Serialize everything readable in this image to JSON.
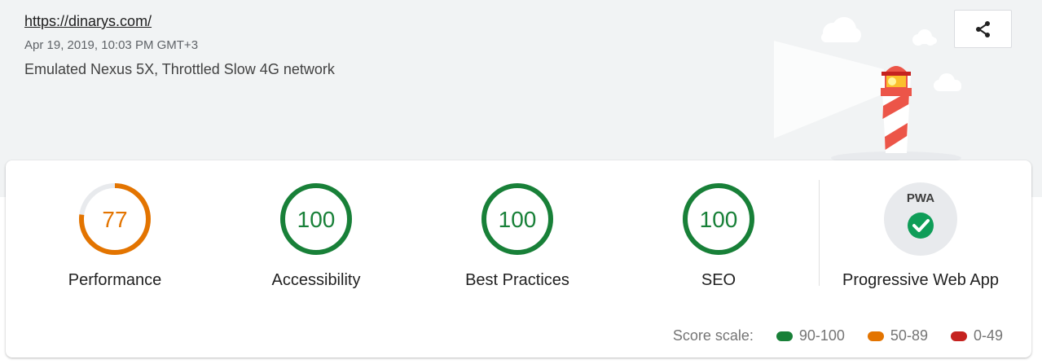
{
  "header": {
    "url": "https://dinarys.com/",
    "timestamp": "Apr 19, 2019, 10:03 PM GMT+3",
    "device": "Emulated Nexus 5X, Throttled Slow 4G network",
    "share_icon": "share-icon",
    "illustration": "lighthouse-illustration"
  },
  "categories": [
    {
      "label": "Performance",
      "score": 77,
      "score_text": "77",
      "status": "average"
    },
    {
      "label": "Accessibility",
      "score": 100,
      "score_text": "100",
      "status": "pass"
    },
    {
      "label": "Best Practices",
      "score": 100,
      "score_text": "100",
      "status": "pass"
    },
    {
      "label": "SEO",
      "score": 100,
      "score_text": "100",
      "status": "pass"
    }
  ],
  "pwa": {
    "label": "Progressive Web App",
    "badge_text": "PWA",
    "icon": "check-icon"
  },
  "score_scale": {
    "label": "Score scale:",
    "ranges": [
      {
        "label": "90-100",
        "color": "#188038"
      },
      {
        "label": "50-89",
        "color": "#e37400"
      },
      {
        "label": "0-49",
        "color": "#c5221f"
      }
    ]
  },
  "colors": {
    "pass": "#188038",
    "average": "#e37400",
    "fail": "#c5221f",
    "track": "#e8eaed"
  }
}
